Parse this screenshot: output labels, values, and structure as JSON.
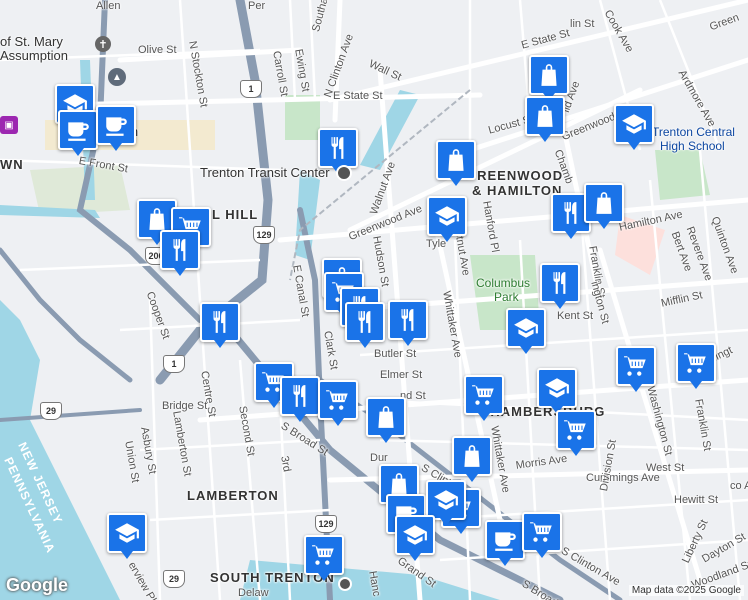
{
  "map": {
    "neighborhoods": {
      "greenwood": "GREENWOOD",
      "hamilton": "& HAMILTON",
      "chambersburg": "CHAMBERSBURG",
      "lamberton": "LAMBERTON",
      "south_trenton": "SOUTH TRENTON",
      "mill_hill": "LL HILL",
      "town": "WN",
      "new_jersey": "NEW JERSEY",
      "pennsylvania": "PENNSYLVANIA"
    },
    "places": {
      "st_mary": "of St. Mary",
      "assumption": "Assumption",
      "transit": "Trenton Transit Center",
      "columbus": "Columbus",
      "park": "Park",
      "central": "Trenton Central",
      "high_school": "High School",
      "ton": "ton"
    },
    "streets": {
      "olive": "Olive St",
      "n_stockton": "N Stockton St",
      "carroll": "Carroll St",
      "ewing": "Ewing St",
      "n_clinton": "N Clinton Ave",
      "e_state_top": "E State St",
      "e_state": "E State St",
      "wall": "Wall St",
      "e_front": "E Front St",
      "greenwood": "Greenwood Ave",
      "greenwood2": "Greenwood Ave",
      "walnut": "Walnut Ave",
      "hudson": "Hudson St",
      "tyler": "Tyle",
      "chestnut": "hestnut Ave",
      "hanford": "Hanford Pl",
      "hamilton": "Hamilton Ave",
      "e_canal": "E Canal St",
      "clark": "Clark St",
      "butler": "Butler St",
      "elmer": "Elmer St",
      "whittaker": "Whittaker Ave",
      "whittaker2": "Whittaker Ave",
      "kent": "Kent St",
      "cooper": "Cooper St",
      "centre": "Centre St",
      "bridge": "Bridge St",
      "asbury": "Asbury St",
      "lamberton_st": "Lamberton St",
      "union": "Union St",
      "second": "Second St",
      "third": "3rd",
      "s_broad": "S Broad St",
      "s_broad2": "S Broad St",
      "s_clinton": "S Clinton Ave",
      "s_clinton2": "S Clinton Ave",
      "morris": "Morris Ave",
      "cummings": "Cummings Ave",
      "west": "West St",
      "hewitt": "Hewitt St",
      "franklin": "Franklin St",
      "franklin2": "Franklin St",
      "washington": "Washington St",
      "division": "Division St",
      "liberty": "Liberty St",
      "dayton": "Dayton St",
      "woodland": "Woodland St",
      "mifflin": "Mifflin St",
      "bert": "Bert Ave",
      "revere": "Revere Ave",
      "quinton": "Quinton Ave",
      "locust": "Locust St",
      "ardmore": "Ardmore Ave",
      "cook": "Cook Ave",
      "green": "Green",
      "grand": "Grand St",
      "hanc": "Hanc",
      "ervi": "erview Pl",
      "southard": "Southard",
      "ablingt": "ablingt",
      "ington": "ington St",
      "chamb": "Chamb",
      "delaw": "Delaw",
      "allen": "Allen",
      "per": "Per",
      "lin_st": "lin St",
      "lid_ave": "lid Ave",
      "nd_st": "nd St",
      "dur": "Dur",
      "f_st": "F",
      "co_ave": "co Ave"
    },
    "shields": [
      "1",
      "206",
      "129",
      "1",
      "29",
      "129",
      "29"
    ],
    "pins": [
      {
        "icon": "school-icon",
        "type": "school"
      },
      {
        "icon": "coffee-icon",
        "type": "cafe"
      },
      {
        "icon": "coffee-icon",
        "type": "cafe"
      },
      {
        "icon": "restaurant-icon",
        "type": "restaurant"
      },
      {
        "icon": "bag-icon",
        "type": "store"
      },
      {
        "icon": "bag-icon",
        "type": "store"
      },
      {
        "icon": "school-icon",
        "type": "school"
      },
      {
        "icon": "bag-icon",
        "type": "store"
      },
      {
        "icon": "bag-icon",
        "type": "store"
      },
      {
        "icon": "cart-icon",
        "type": "grocery"
      },
      {
        "icon": "restaurant-icon",
        "type": "restaurant"
      },
      {
        "icon": "school-icon",
        "type": "school"
      },
      {
        "icon": "restaurant-icon",
        "type": "restaurant"
      },
      {
        "icon": "bag-icon",
        "type": "store"
      },
      {
        "icon": "restaurant-icon",
        "type": "restaurant"
      },
      {
        "icon": "bag-icon",
        "type": "store"
      },
      {
        "icon": "cart-icon",
        "type": "grocery"
      },
      {
        "icon": "restaurant-icon",
        "type": "restaurant"
      },
      {
        "icon": "restaurant-icon",
        "type": "restaurant"
      },
      {
        "icon": "restaurant-icon",
        "type": "restaurant"
      },
      {
        "icon": "restaurant-icon",
        "type": "restaurant"
      },
      {
        "icon": "school-icon",
        "type": "school"
      },
      {
        "icon": "cart-icon",
        "type": "grocery"
      },
      {
        "icon": "cart-icon",
        "type": "grocery"
      },
      {
        "icon": "cart-icon",
        "type": "grocery"
      },
      {
        "icon": "restaurant-icon",
        "type": "restaurant"
      },
      {
        "icon": "cart-icon",
        "type": "grocery"
      },
      {
        "icon": "bag-icon",
        "type": "store"
      },
      {
        "icon": "cart-icon",
        "type": "grocery"
      },
      {
        "icon": "school-icon",
        "type": "school"
      },
      {
        "icon": "cart-icon",
        "type": "grocery"
      },
      {
        "icon": "bag-icon",
        "type": "store"
      },
      {
        "icon": "bag-icon",
        "type": "store"
      },
      {
        "icon": "coffee-icon",
        "type": "cafe"
      },
      {
        "icon": "cart-icon",
        "type": "grocery"
      },
      {
        "icon": "school-icon",
        "type": "school"
      },
      {
        "icon": "school-icon",
        "type": "school"
      },
      {
        "icon": "coffee-icon",
        "type": "cafe"
      },
      {
        "icon": "cart-icon",
        "type": "grocery"
      },
      {
        "icon": "cart-icon",
        "type": "grocery"
      },
      {
        "icon": "school-icon",
        "type": "school"
      }
    ]
  },
  "footer": {
    "logo": "Google",
    "attribution": "Map data ©2025 Google"
  },
  "colors": {
    "water": "#9fd6e6",
    "park": "#c8e6c9",
    "highway": "#8a9bb1",
    "road": "#ffffff",
    "pin": "#1a73e8"
  }
}
